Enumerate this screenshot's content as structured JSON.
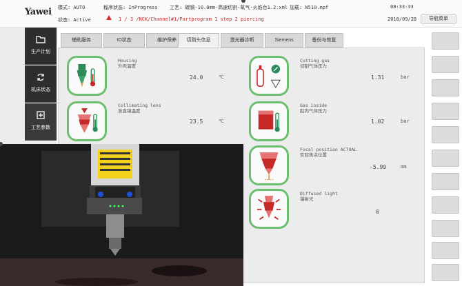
{
  "app": {
    "logo": "Yawei"
  },
  "header": {
    "mode_label": "模式: AUTO",
    "program_status": "程序状态: InProgress",
    "process": "工艺: 碳钢-10.0mm-高速切割-氧气-火焰台1.2.xml",
    "machining": "加载: N510.mpf",
    "time": "08:33:33",
    "state": "状态: Active",
    "alarm": "1 / 3   /NCK/Channel#1/Partprogram  1  step 2 piercing",
    "date": "2018/09/28",
    "guide_button": "导航菜单"
  },
  "leftnav": [
    {
      "label": "生产计划",
      "icon": "folder-icon"
    },
    {
      "label": "机床状态",
      "icon": "refresh-icon"
    },
    {
      "label": "工艺参数",
      "icon": "process-icon"
    }
  ],
  "tabs": [
    "辅助服务",
    "IO状态",
    "维护保养",
    "切割头信息",
    "激光器诊断",
    "Siemens",
    "备份与恢复"
  ],
  "active_tab": "切割头信息",
  "left_items": [
    {
      "label_en": "Housing",
      "label_cn": "外壳温度",
      "value": "24.0",
      "unit": "℃",
      "icon": "housing-temperature-icon"
    },
    {
      "label_en": "Collimating lens",
      "label_cn": "准直镜温度",
      "value": "23.5",
      "unit": "℃",
      "icon": "collimating-lens-icon"
    }
  ],
  "right_items": [
    {
      "label_en": "Cutting gas",
      "label_cn": "切割气体压力",
      "value": "1.31",
      "unit": "bar",
      "icon": "cutting-gas-icon"
    },
    {
      "label_en": "Gas inside",
      "label_cn": "腔内气体压力",
      "value": "1.02",
      "unit": "bar",
      "icon": "gas-inside-icon"
    },
    {
      "label_en": "Focal position ACTUAL",
      "label_cn": "实际焦点位置",
      "value": "-5.99",
      "unit": "mm",
      "icon": "focal-position-icon"
    },
    {
      "label_en": "Diffused light",
      "label_cn": "漫射光",
      "value": "0",
      "unit": "",
      "icon": "diffused-light-icon"
    }
  ],
  "right_buttons": [
    "",
    "",
    "",
    "",
    "",
    "",
    "",
    "",
    "",
    "",
    "",
    ""
  ],
  "colors": {
    "accent_green": "#6bbf6f",
    "alarm_red": "#c62828",
    "nav_dark": "#2e2e2e"
  }
}
